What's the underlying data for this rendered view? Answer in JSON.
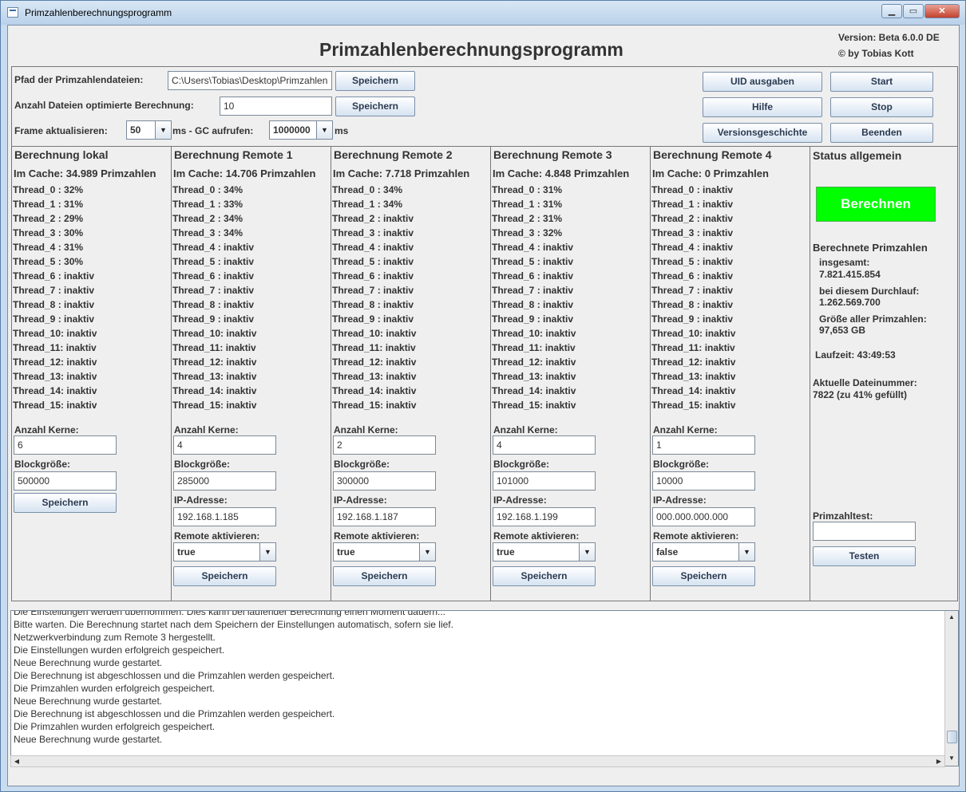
{
  "window": {
    "title": "Primzahlenberechnungsprogramm"
  },
  "header": {
    "headline": "Primzahlenberechnungsprogramm",
    "version": "Version: Beta 6.0.0 DE",
    "author": "© by Tobias Kott"
  },
  "settings": {
    "path_label": "Pfad der Primzahlendateien:",
    "path_value": "C:\\Users\\Tobias\\Desktop\\Primzahlen",
    "path_save": "Speichern",
    "files_label": "Anzahl Dateien optimierte Berechnung:",
    "files_value": "10",
    "files_save": "Speichern",
    "frame_label": "Frame aktualisieren:",
    "frame_value": "50",
    "ms_gc_label": "ms -  GC aufrufen:",
    "gc_value": "1000000",
    "ms_label": "ms"
  },
  "actions": {
    "uid": "UID ausgaben",
    "start": "Start",
    "help": "Hilfe",
    "stop": "Stop",
    "history": "Versionsgeschichte",
    "quit": "Beenden"
  },
  "labels": {
    "cores": "Anzahl Kerne:",
    "block": "Blockgröße:",
    "ip": "IP-Adresse:",
    "remote": "Remote aktivieren:",
    "save": "Speichern"
  },
  "local": {
    "title": "Berechnung lokal",
    "cache": "Im Cache: 34.989 Primzahlen",
    "threads": [
      "Thread_0  : 32%",
      "Thread_1  : 31%",
      "Thread_2  : 29%",
      "Thread_3  : 30%",
      "Thread_4  : 31%",
      "Thread_5  : 30%",
      "Thread_6  : inaktiv",
      "Thread_7  : inaktiv",
      "Thread_8  : inaktiv",
      "Thread_9  : inaktiv",
      "Thread_10: inaktiv",
      "Thread_11: inaktiv",
      "Thread_12: inaktiv",
      "Thread_13: inaktiv",
      "Thread_14: inaktiv",
      "Thread_15: inaktiv"
    ],
    "cores": "6",
    "block": "500000"
  },
  "remotes": [
    {
      "title": "Berechnung Remote 1",
      "cache": "Im Cache: 14.706 Primzahlen",
      "threads": [
        "Thread_0  : 34%",
        "Thread_1  : 33%",
        "Thread_2  : 34%",
        "Thread_3  : 34%",
        "Thread_4  : inaktiv",
        "Thread_5  : inaktiv",
        "Thread_6  : inaktiv",
        "Thread_7  : inaktiv",
        "Thread_8  : inaktiv",
        "Thread_9  : inaktiv",
        "Thread_10: inaktiv",
        "Thread_11: inaktiv",
        "Thread_12: inaktiv",
        "Thread_13: inaktiv",
        "Thread_14: inaktiv",
        "Thread_15: inaktiv"
      ],
      "cores": "4",
      "block": "285000",
      "ip": "192.168.1.185",
      "active": "true"
    },
    {
      "title": "Berechnung Remote 2",
      "cache": "Im Cache: 7.718 Primzahlen",
      "threads": [
        "Thread_0  : 34%",
        "Thread_1  : 34%",
        "Thread_2  : inaktiv",
        "Thread_3  : inaktiv",
        "Thread_4  : inaktiv",
        "Thread_5  : inaktiv",
        "Thread_6  : inaktiv",
        "Thread_7  : inaktiv",
        "Thread_8  : inaktiv",
        "Thread_9  : inaktiv",
        "Thread_10: inaktiv",
        "Thread_11: inaktiv",
        "Thread_12: inaktiv",
        "Thread_13: inaktiv",
        "Thread_14: inaktiv",
        "Thread_15: inaktiv"
      ],
      "cores": "2",
      "block": "300000",
      "ip": "192.168.1.187",
      "active": "true"
    },
    {
      "title": "Berechnung Remote 3",
      "cache": "Im Cache: 4.848 Primzahlen",
      "threads": [
        "Thread_0  : 31%",
        "Thread_1  : 31%",
        "Thread_2  : 31%",
        "Thread_3  : 32%",
        "Thread_4  : inaktiv",
        "Thread_5  : inaktiv",
        "Thread_6  : inaktiv",
        "Thread_7  : inaktiv",
        "Thread_8  : inaktiv",
        "Thread_9  : inaktiv",
        "Thread_10: inaktiv",
        "Thread_11: inaktiv",
        "Thread_12: inaktiv",
        "Thread_13: inaktiv",
        "Thread_14: inaktiv",
        "Thread_15: inaktiv"
      ],
      "cores": "4",
      "block": "101000",
      "ip": "192.168.1.199",
      "active": "true"
    },
    {
      "title": "Berechnung Remote 4",
      "cache": "Im Cache: 0 Primzahlen",
      "threads": [
        "Thread_0  : inaktiv",
        "Thread_1  : inaktiv",
        "Thread_2  : inaktiv",
        "Thread_3  : inaktiv",
        "Thread_4  : inaktiv",
        "Thread_5  : inaktiv",
        "Thread_6  : inaktiv",
        "Thread_7  : inaktiv",
        "Thread_8  : inaktiv",
        "Thread_9  : inaktiv",
        "Thread_10: inaktiv",
        "Thread_11: inaktiv",
        "Thread_12: inaktiv",
        "Thread_13: inaktiv",
        "Thread_14: inaktiv",
        "Thread_15: inaktiv"
      ],
      "cores": "1",
      "block": "10000",
      "ip": "000.000.000.000",
      "active": "false"
    }
  ],
  "status": {
    "title": "Status allgemein",
    "compute_label": "Berechnen",
    "computed_label": "Berechnete Primzahlen",
    "total_label": "insgesamt:",
    "total_value": "7.821.415.854",
    "run_label": "bei diesem Durchlauf:",
    "run_value": "1.262.569.700",
    "size_label": "Größe aller Primzahlen:",
    "size_value": "97,653 GB",
    "runtime": "Laufzeit: 43:49:53",
    "filenum_label": "Aktuelle Dateinummer:",
    "filenum_value": "7822 (zu 41% gefüllt)",
    "test_label": "Primzahltest:",
    "test_value": "",
    "test_button": "Testen",
    "green": "#00ff00"
  },
  "log": [
    "Die Einstellungen werden übernommen. Dies kann bei laufender Berechnung einen Moment dauern...",
    "Bitte warten. Die Berechnung startet nach dem Speichern der Einstellungen automatisch, sofern sie lief.",
    "Netzwerkverbindung zum Remote 3 hergestellt.",
    "Die Einstellungen wurden erfolgreich gespeichert.",
    "Neue Berechnung wurde gestartet.",
    "Die Berechnung ist abgeschlossen und die Primzahlen werden gespeichert.",
    "Die Primzahlen wurden erfolgreich gespeichert.",
    "Neue Berechnung wurde gestartet.",
    "Die Berechnung ist abgeschlossen und die Primzahlen werden gespeichert.",
    "Die Primzahlen wurden erfolgreich gespeichert.",
    "Neue Berechnung wurde gestartet."
  ]
}
